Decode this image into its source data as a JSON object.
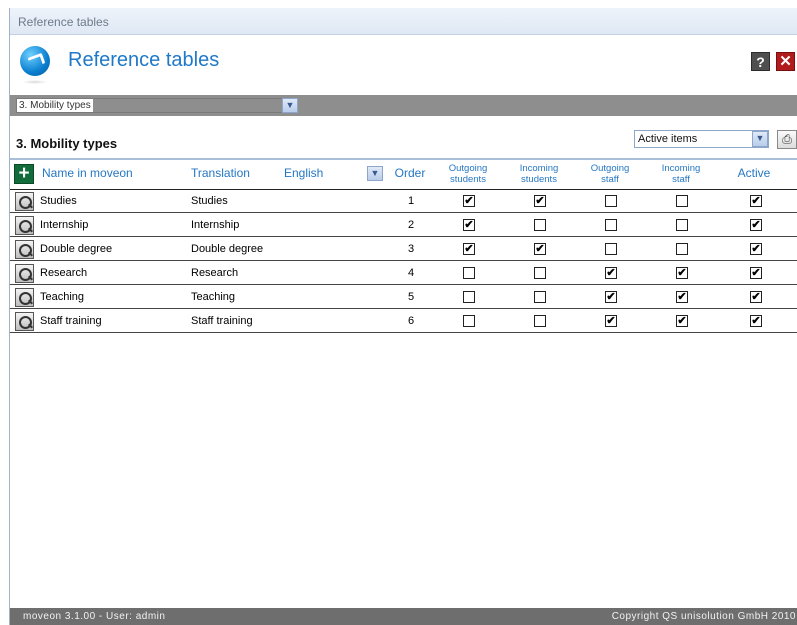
{
  "window": {
    "title": "Reference tables"
  },
  "header": {
    "title": "Reference tables",
    "help_label": "?",
    "close_label": "✕"
  },
  "table_selector": {
    "value": "3. Mobility types"
  },
  "section": {
    "title": "3. Mobility types"
  },
  "filter": {
    "value": "Active items"
  },
  "icons": {
    "print": "⎙",
    "add": "+",
    "dropdown": "▼",
    "check": "✔"
  },
  "columns": {
    "name": "Name in moveon",
    "translation": "Translation",
    "language": "English",
    "order": "Order",
    "outgoing_students": [
      "Outgoing",
      "students"
    ],
    "incoming_students": [
      "Incoming",
      "students"
    ],
    "outgoing_staff": [
      "Outgoing",
      "staff"
    ],
    "incoming_staff": [
      "Incoming",
      "staff"
    ],
    "active": "Active"
  },
  "rows": [
    {
      "name": "Studies",
      "translation": "Studies",
      "order": "1",
      "flags": [
        true,
        true,
        false,
        false,
        true
      ]
    },
    {
      "name": "Internship",
      "translation": "Internship",
      "order": "2",
      "flags": [
        true,
        false,
        false,
        false,
        true
      ]
    },
    {
      "name": "Double degree",
      "translation": "Double degree",
      "order": "3",
      "flags": [
        true,
        true,
        false,
        false,
        true
      ]
    },
    {
      "name": "Research",
      "translation": "Research",
      "order": "4",
      "flags": [
        false,
        false,
        true,
        true,
        true
      ]
    },
    {
      "name": "Teaching",
      "translation": "Teaching",
      "order": "5",
      "flags": [
        false,
        false,
        true,
        true,
        true
      ]
    },
    {
      "name": "Staff training",
      "translation": "Staff training",
      "order": "6",
      "flags": [
        false,
        false,
        true,
        true,
        true
      ]
    }
  ],
  "footer": {
    "left": "moveon 3.1.00 - User: admin",
    "right": "Copyright QS unisolution GmbH 2010"
  }
}
